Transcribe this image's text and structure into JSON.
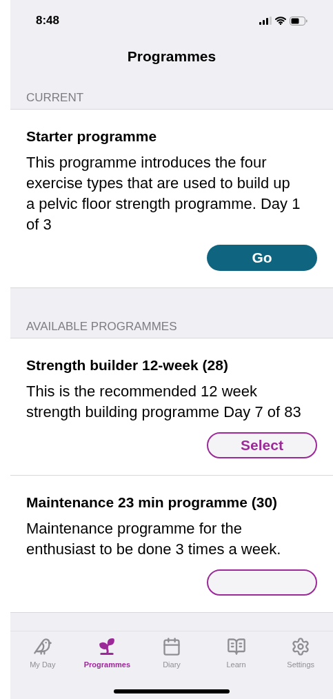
{
  "status_bar": {
    "time": "8:48"
  },
  "header": {
    "title": "Programmes"
  },
  "sections": [
    {
      "title": "CURRENT",
      "programmes": [
        {
          "name": "Starter programme",
          "description": "This programme introduces the four exercise types that are used to build up a pelvic floor strength programme. Day 1 of 3",
          "button": {
            "kind": "go",
            "label": "Go"
          }
        }
      ]
    },
    {
      "title": "AVAILABLE PROGRAMMES",
      "programmes": [
        {
          "name": "Strength builder 12-week (28)",
          "description": "This is the recommended 12 week strength building programme Day 7 of 83",
          "button": {
            "kind": "select",
            "label": "Select"
          }
        },
        {
          "name": "Maintenance 23 min programme (30)",
          "description": "Maintenance programme for the enthusiast to be done 3 times a week.",
          "button": {
            "kind": "select"
          }
        }
      ]
    }
  ],
  "tab_bar": [
    {
      "label": "My Day",
      "selected": false
    },
    {
      "label": "Programmes",
      "selected": true
    },
    {
      "label": "Diary",
      "selected": false
    },
    {
      "label": "Learn",
      "selected": false
    },
    {
      "label": "Settings",
      "selected": false
    }
  ]
}
